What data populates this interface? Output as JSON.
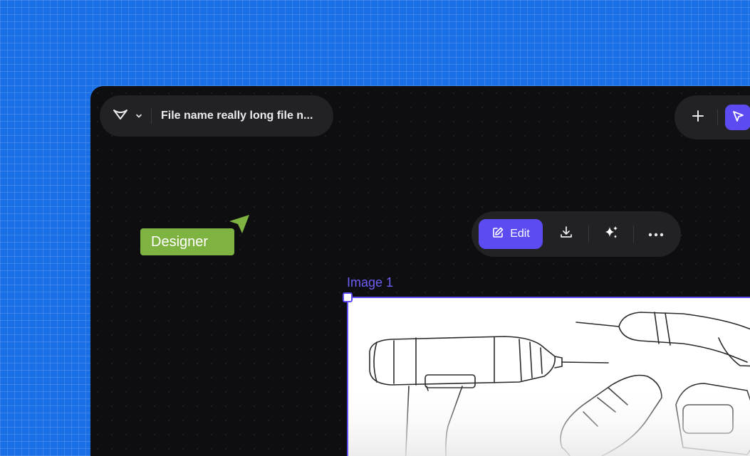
{
  "header": {
    "file_name": "File name really long file n...",
    "logo_icon": "logo-chevron-icon",
    "menu_icon": "chevron-down-icon"
  },
  "top_toolbar": {
    "tools": [
      "plus-icon",
      "select-arrow-icon"
    ]
  },
  "collaborator": {
    "name": "Designer",
    "color": "#7fb341"
  },
  "context_toolbar": {
    "edit_label": "Edit",
    "actions": [
      "download-icon",
      "sparkles-icon",
      "more-icon"
    ]
  },
  "canvas": {
    "image_label": "Image 1"
  },
  "colors": {
    "accent": "#5b4bf0",
    "background": "#1a6fe6",
    "canvas": "#0e0e10"
  }
}
